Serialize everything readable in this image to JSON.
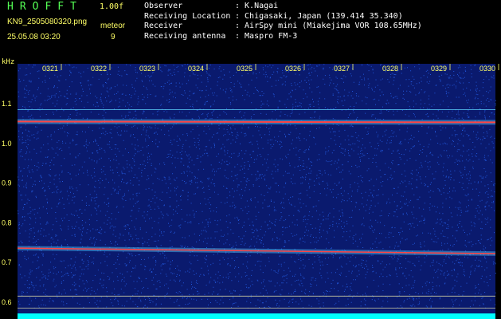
{
  "header": {
    "app_title": "HROFFT",
    "version": "1.00f",
    "filename": "KN9_2505080320.png",
    "meteor_label": "meteor",
    "meteor_count": "9",
    "datetime": "25.05.08 03:20"
  },
  "info": [
    {
      "key": "Observer",
      "value": ": K.Nagai"
    },
    {
      "key": "Receiving Location",
      "value": ": Chigasaki, Japan (139.414 35.340)"
    },
    {
      "key": "Receiver",
      "value": ": AirSpy mini (Miakejima VOR 108.65MHz)"
    },
    {
      "key": "Receiving antenna",
      "value": ": Maspro FM-3"
    }
  ],
  "spectrogram": {
    "y_unit": "kHz",
    "y_ticks": [
      "1.1",
      "1.0",
      "0.9",
      "0.8",
      "0.7",
      "0.6"
    ],
    "time_ticks": [
      "0321",
      "0322",
      "0323",
      "0324",
      "0325",
      "0326",
      "0327",
      "0328",
      "0329",
      "0330"
    ],
    "colors": {
      "background": "#0a1a6e",
      "noise": "#2a6bff",
      "signal": "#ff4444",
      "baseline": "#00ffff",
      "labels": "#ffff66"
    }
  }
}
